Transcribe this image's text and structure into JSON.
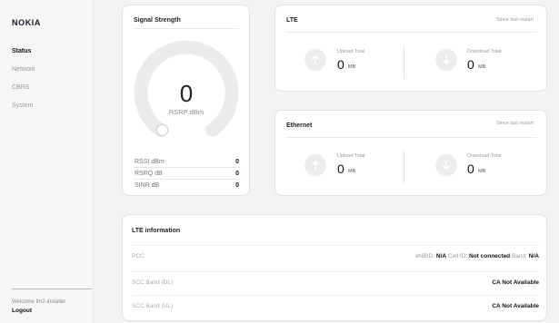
{
  "brand": "NOKIA",
  "nav": [
    {
      "label": "Status",
      "active": true
    },
    {
      "label": "Network",
      "active": false
    },
    {
      "label": "CBRS",
      "active": false
    },
    {
      "label": "System",
      "active": false
    }
  ],
  "user": {
    "welcome": "Welcome fm2-installer",
    "logout": "Logout"
  },
  "signal": {
    "title": "Signal Strength",
    "rsrp_value": "0",
    "rsrp_unit": "RSRP dBm",
    "gauge_level": 0,
    "stats": [
      {
        "label": "RSSI dBm",
        "value": "0"
      },
      {
        "label": "RSRQ dB",
        "value": "0"
      },
      {
        "label": "SINR dB",
        "value": "0"
      }
    ]
  },
  "lte": {
    "title": "LTE",
    "since": "Since last restart",
    "upload_label": "Upload Total",
    "upload_value": "0",
    "upload_unit": "MB",
    "download_label": "Download Total",
    "download_value": "0",
    "download_unit": "MB"
  },
  "ethernet": {
    "title": "Ethernet",
    "since": "Since last restart",
    "upload_label": "Upload Total",
    "upload_value": "0",
    "upload_unit": "MB",
    "download_label": "Download Total",
    "download_value": "0",
    "download_unit": "MB"
  },
  "lte_info": {
    "title": "LTE information",
    "pcc": {
      "label": "PCC",
      "enbid_key": "eNBID:",
      "enbid_val": "N/A",
      "cellid_key": "Cell ID:",
      "cellid_val": "Not connected",
      "band_key": "Band:",
      "band_val": "N/A"
    },
    "scc_dl": {
      "label": "SCC Band (DL)",
      "value": "CA Not Available"
    },
    "scc_ul": {
      "label": "SCC Band (UL)",
      "value": "CA Not Available"
    }
  },
  "colors": {
    "gauge_track": "#ebebeb",
    "gauge_knob": "#ffffff",
    "icon_circle": "#ececec"
  },
  "icons": {
    "upload": "arrow-up-icon",
    "download": "arrow-down-icon"
  }
}
